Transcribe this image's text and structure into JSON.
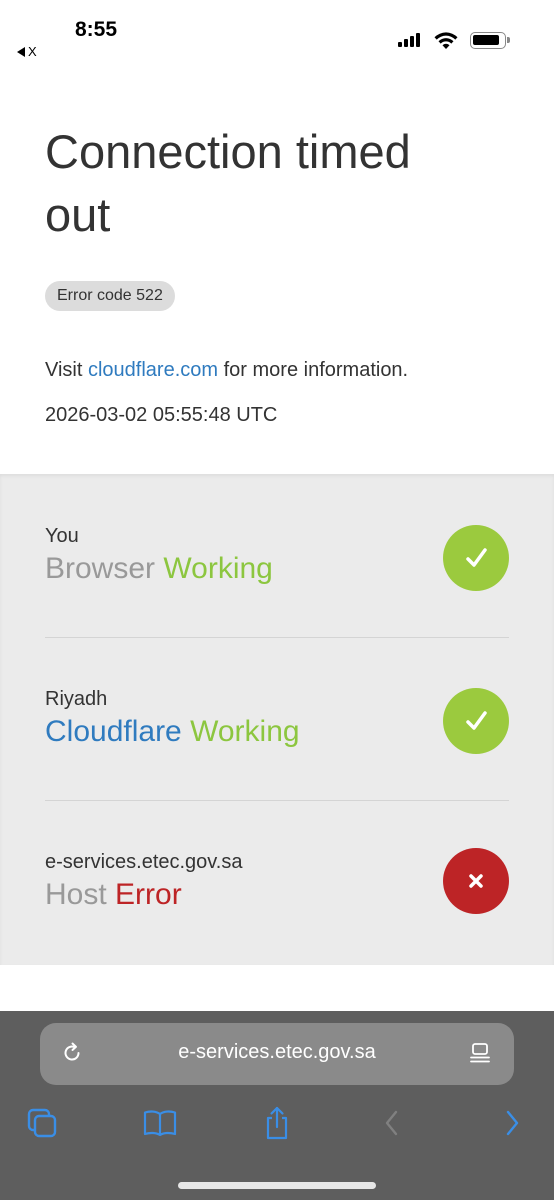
{
  "status_bar": {
    "time": "8:55",
    "back_label": "X"
  },
  "page": {
    "title": "Connection timed out",
    "error_code": "Error code 522",
    "visit_prefix": "Visit ",
    "visit_link": "cloudflare.com",
    "visit_suffix": " for more information.",
    "timestamp": "2026-03-02 05:55:48 UTC"
  },
  "status_rows": [
    {
      "label": "You",
      "name": "Browser",
      "state": "Working",
      "ok": true
    },
    {
      "label": "Riyadh",
      "name": "Cloudflare",
      "state": "Working",
      "ok": true
    },
    {
      "label": "e-services.etec.gov.sa",
      "name": "Host",
      "state": "Error",
      "ok": false
    }
  ],
  "browser": {
    "url": "e-services.etec.gov.sa"
  },
  "colors": {
    "working": "#8cc63f",
    "error": "#bd2426",
    "link": "#2f7bbf",
    "toolbar_accent": "#3a8ee6"
  }
}
